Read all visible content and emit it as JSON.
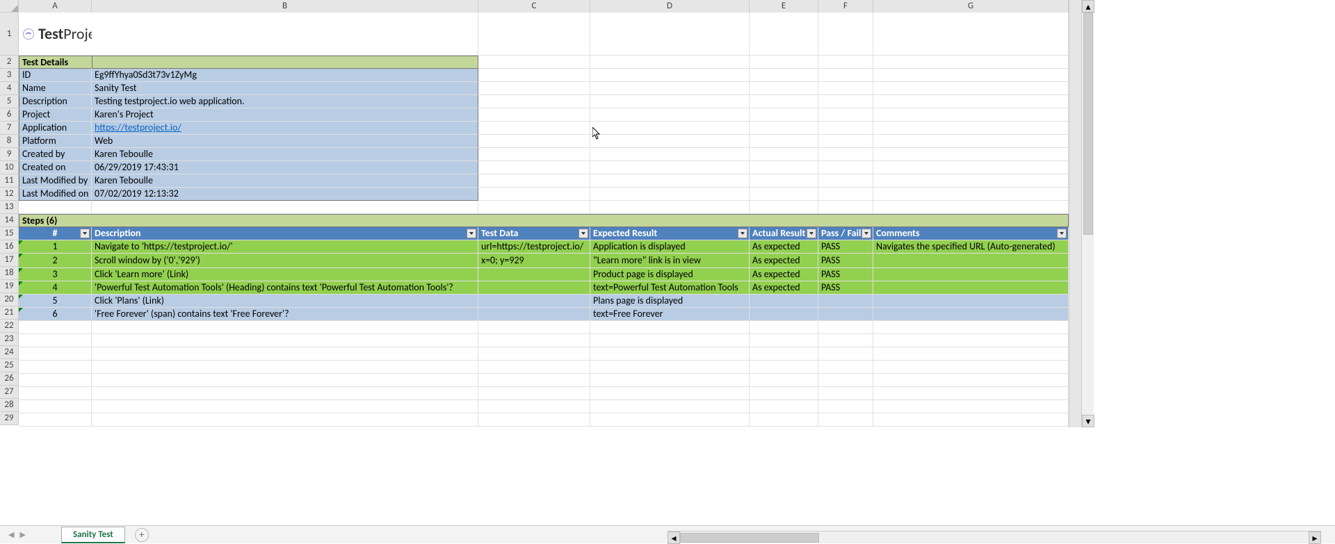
{
  "columns": [
    "A",
    "B",
    "C",
    "D",
    "E",
    "F",
    "G"
  ],
  "row_count": 29,
  "logo": {
    "prefix": "Test",
    "suffix": "Project"
  },
  "section_test_details": "Test Details",
  "details": [
    {
      "label": "ID",
      "value": "Eg9ffYhya0Sd3t73v1ZyMg"
    },
    {
      "label": "Name",
      "value": "Sanity Test"
    },
    {
      "label": "Description",
      "value": "Testing testproject.io web application."
    },
    {
      "label": "Project",
      "value": "Karen's Project"
    },
    {
      "label": "Application",
      "value": "https://testproject.io/",
      "link": true
    },
    {
      "label": "Platform",
      "value": "Web"
    },
    {
      "label": "Created by",
      "value": "Karen Teboulle"
    },
    {
      "label": "Created on",
      "value": "06/29/2019 17:43:31"
    },
    {
      "label": "Last Modified by",
      "value": "Karen Teboulle"
    },
    {
      "label": "Last Modified on",
      "value": "07/02/2019 12:13:32"
    }
  ],
  "section_steps": "Steps (6)",
  "steps_columns": {
    "num": "#",
    "description": "Description",
    "test_data": "Test Data",
    "expected": "Expected Result",
    "actual": "Actual Result",
    "passfail": "Pass / Fail",
    "comments": "Comments"
  },
  "steps": [
    {
      "n": "1",
      "desc": "Navigate to 'https://testproject.io/'",
      "test_data": "url=https://testproject.io/",
      "expected": "Application is displayed",
      "actual": "As expected",
      "passfail": "PASS",
      "comments": "Navigates the specified URL (Auto-generated)",
      "style": "pass"
    },
    {
      "n": "2",
      "desc": "Scroll window by ('0','929')",
      "test_data": "x=0; y=929",
      "expected": "\"Learn more\" link is in view",
      "actual": "As expected",
      "passfail": "PASS",
      "comments": "",
      "style": "pass"
    },
    {
      "n": "3",
      "desc": "Click 'Learn more' (Link)",
      "test_data": "",
      "expected": "Product page is displayed",
      "actual": "As expected",
      "passfail": "PASS",
      "comments": "",
      "style": "pass"
    },
    {
      "n": "4",
      "desc": "'Powerful Test Automation Tools' (Heading) contains text 'Powerful Test Automation Tools'?",
      "test_data": "",
      "expected": "text=Powerful Test Automation Tools",
      "actual": "As expected",
      "passfail": "PASS",
      "comments": "",
      "style": "pass"
    },
    {
      "n": "5",
      "desc": "Click 'Plans' (Link)",
      "test_data": "",
      "expected": "Plans page is displayed",
      "actual": "",
      "passfail": "",
      "comments": "",
      "style": "blue"
    },
    {
      "n": "6",
      "desc": "'Free Forever' (span) contains text 'Free Forever'?",
      "test_data": "",
      "expected": "text=Free Forever",
      "actual": "",
      "passfail": "",
      "comments": "",
      "style": "blue"
    }
  ],
  "active_tab": "Sanity Test"
}
